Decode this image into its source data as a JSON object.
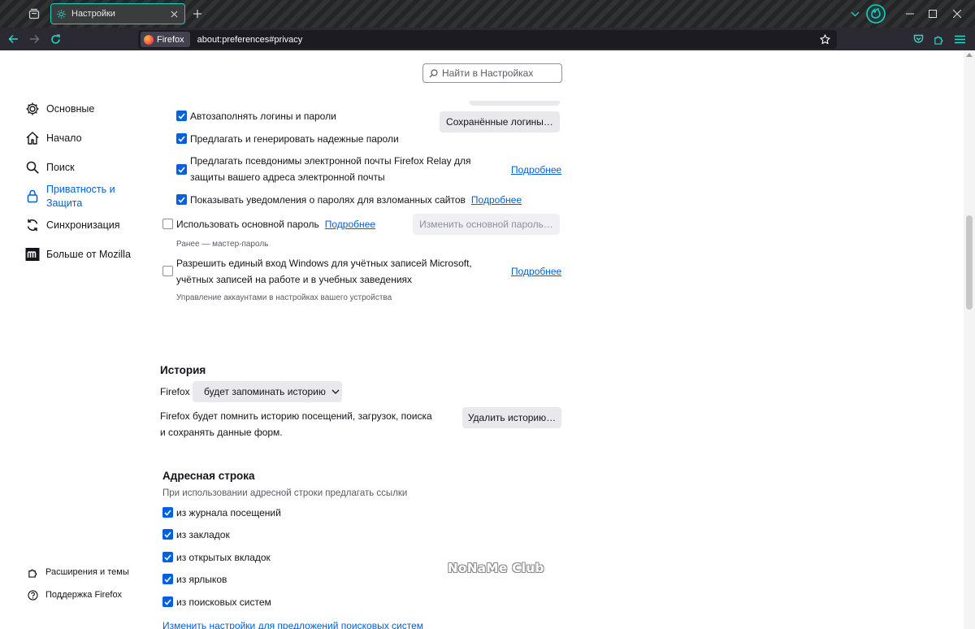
{
  "browser": {
    "tab_title": "Настройки",
    "identity_label": "Firefox",
    "url": "about:preferences#privacy"
  },
  "search": {
    "placeholder": "Найти в Настройках"
  },
  "sidebar": {
    "categories": [
      {
        "label": "Основные",
        "icon": "gear-icon"
      },
      {
        "label": "Начало",
        "icon": "home-icon"
      },
      {
        "label": "Поиск",
        "icon": "magnifier-icon"
      },
      {
        "label": "Приватность и Защита",
        "icon": "lock-icon",
        "selected": true
      },
      {
        "label": "Синхронизация",
        "icon": "sync-icon"
      },
      {
        "label": "Больше от Mozilla",
        "icon": "mozilla-icon"
      }
    ],
    "footer": [
      {
        "label": "Расширения и темы",
        "icon": "puzzle-icon"
      },
      {
        "label": "Поддержка Firefox",
        "icon": "help-icon"
      }
    ]
  },
  "logins": {
    "autofill": {
      "label": "Автозаполнять логины и пароли",
      "checked": true
    },
    "suggest_passwords": {
      "label": "Предлагать и генерировать надежные пароли",
      "checked": true
    },
    "relay": {
      "label": "Предлагать псевдонимы электронной почты Firefox Relay для защиты вашего адреса электронной почты",
      "checked": true,
      "link": "Подробнее"
    },
    "breach_alerts": {
      "label": "Показывать уведомления о паролях для взломанных сайтов",
      "checked": true,
      "link": "Подробнее"
    },
    "saved_logins_button": "Сохранённые логины…",
    "primary_password": {
      "label": "Использовать основной пароль",
      "checked": false,
      "link": "Подробнее",
      "button": "Изменить основной пароль…",
      "hint": "Ранее — мастер-пароль"
    },
    "windows_sso": {
      "label": "Разрешить единый вход Windows для учётных записей Microsoft, учётных записей на работе и в учебных заведениях",
      "checked": false,
      "link": "Подробнее",
      "hint": "Управление аккаунтами в настройках вашего устройства"
    }
  },
  "history": {
    "heading": "История",
    "prefix": "Firefox",
    "mode": "будет запоминать историю",
    "description": "Firefox будет помнить историю посещений, загрузок, поиска и сохранять данные форм.",
    "clear_button": "Удалить историю…"
  },
  "address_bar": {
    "heading": "Адресная строка",
    "subtitle": "При использовании адресной строки предлагать ссылки",
    "options": [
      {
        "label": "из журнала посещений",
        "checked": true
      },
      {
        "label": "из закладок",
        "checked": true
      },
      {
        "label": "из открытых вкладок",
        "checked": true
      },
      {
        "label": "из ярлыков",
        "checked": true
      },
      {
        "label": "из поисковых систем",
        "checked": true
      }
    ],
    "search_link": "Изменить настройки для предложений поисковых систем"
  },
  "watermark": "NoNaMe Club",
  "colors": {
    "accent": "#0061e0",
    "chrome_accent": "#18d2c0",
    "chrome_bg": "#2b2a33"
  }
}
